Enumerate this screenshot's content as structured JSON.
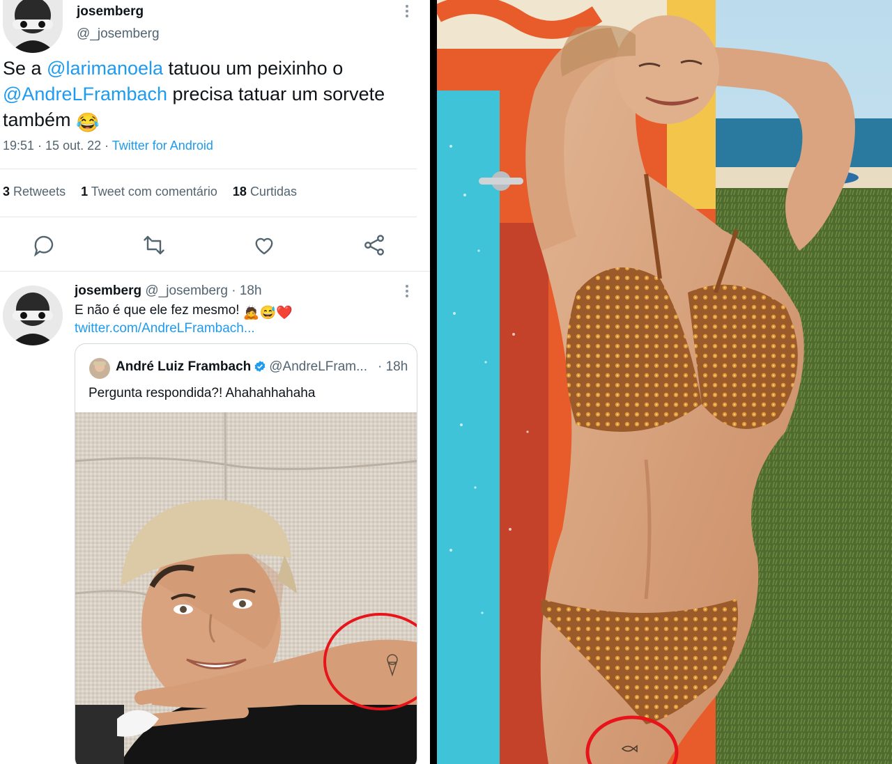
{
  "main_tweet": {
    "display_name": "josemberg",
    "handle": "@_josemberg",
    "text_parts": [
      "Se a ",
      "@larimanoela",
      " tatuou um peixinho o ",
      "@AndreLFrambach",
      " precisa tatuar um sorvete também "
    ],
    "emoji": "😂",
    "time": "19:51 · 15 out. 22 · ",
    "source": "Twitter for Android",
    "stats": {
      "retweets_count": "3",
      "retweets_label": "Retweets",
      "quotes_count": "1",
      "quotes_label": "Tweet com comentário",
      "likes_count": "18",
      "likes_label": "Curtidas"
    }
  },
  "reply_tweet": {
    "display_name": "josemberg",
    "handle": "@_josemberg",
    "age": "· 18h",
    "text": "E não é que ele fez mesmo! ",
    "emojis": [
      "🙇",
      "😅",
      "❤️"
    ],
    "link": "twitter.com/AndreLFrambach..."
  },
  "quoted_tweet": {
    "display_name": "André Luiz Frambach",
    "handle": "@AndreLFram...",
    "age": "· 18h",
    "text": "Pergunta respondida?! Ahahahhahaha"
  },
  "colors": {
    "accent": "#1d9bf0",
    "secondary_text": "#536471",
    "highlight_circle": "#e8141b"
  },
  "icons": [
    "reply-icon",
    "retweet-icon",
    "like-icon",
    "share-icon",
    "more-icon",
    "verified-icon"
  ]
}
